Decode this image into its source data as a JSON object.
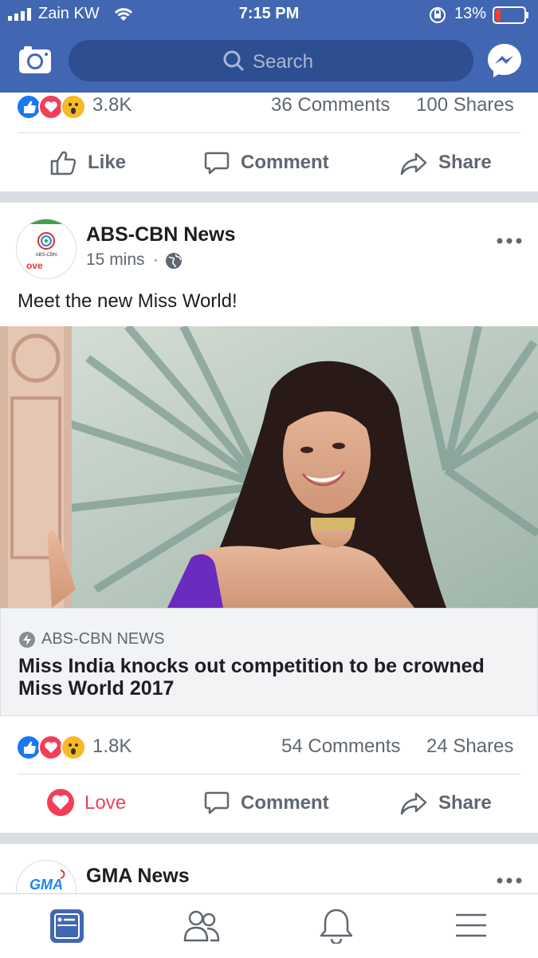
{
  "status_bar": {
    "carrier": "Zain KW",
    "time": "7:15 PM",
    "battery": "13%"
  },
  "header": {
    "search_placeholder": "Search",
    "camera_icon": "camera-icon",
    "messenger_icon": "messenger-icon"
  },
  "top_post": {
    "reactions_count": "3.8K",
    "comments": "36 Comments",
    "shares": "100 Shares",
    "actions": {
      "like": "Like",
      "comment": "Comment",
      "share": "Share"
    }
  },
  "post": {
    "author": "ABS-CBN News",
    "time": "15 mins",
    "text": "Meet the new Miss World!",
    "link_source": "ABS-CBN NEWS",
    "link_title": "Miss India knocks out competition to be crowned Miss World 2017",
    "reactions_count": "1.8K",
    "comments": "54 Comments",
    "shares": "24 Shares",
    "actions": {
      "love": "Love",
      "comment": "Comment",
      "share": "Share"
    },
    "avatar_text": "ABS-CBN",
    "avatar_sub": "Love"
  },
  "next_post": {
    "author": "GMA News",
    "avatar_text": "GMA"
  },
  "bottom_nav": [
    "news-feed-icon",
    "friends-icon",
    "notifications-icon",
    "menu-icon"
  ],
  "colors": {
    "brand": "#4267b2",
    "love": "#f33e58",
    "link_bg": "#f2f3f5"
  }
}
